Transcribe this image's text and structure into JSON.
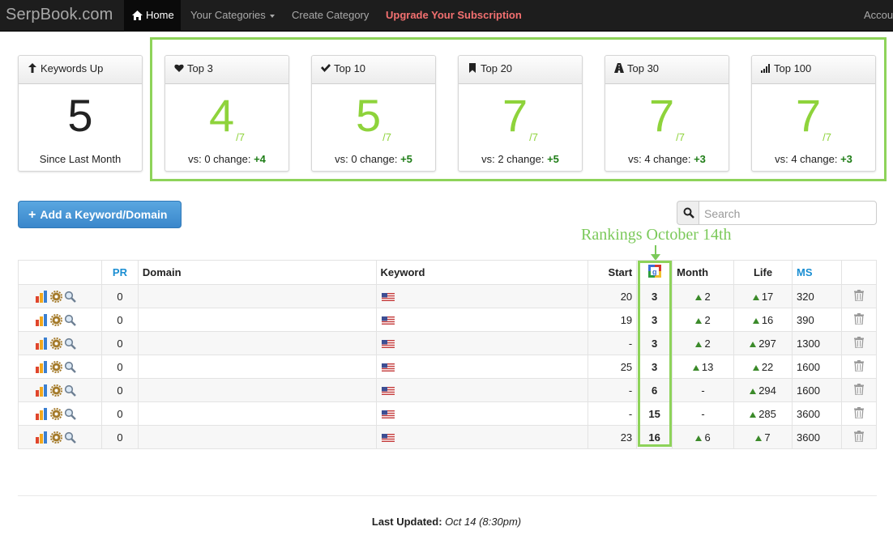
{
  "nav": {
    "brand": "SerpBook.com",
    "home": "Home",
    "categories": "Your Categories",
    "create": "Create Category",
    "upgrade": "Upgrade Your Subscription",
    "account": "Accou"
  },
  "cards": [
    {
      "title": "Keywords Up",
      "icon": "arrow-up-icon",
      "value": "5",
      "denom": "",
      "foot": "Since Last Month",
      "delta": ""
    },
    {
      "title": "Top 3",
      "icon": "heart-icon",
      "value": "4",
      "denom": "/7",
      "foot": "vs: 0 change:",
      "delta": "+4"
    },
    {
      "title": "Top 10",
      "icon": "check-icon",
      "value": "5",
      "denom": "/7",
      "foot": "vs: 0 change:",
      "delta": "+5"
    },
    {
      "title": "Top 20",
      "icon": "bookmark-icon",
      "value": "7",
      "denom": "/7",
      "foot": "vs: 2 change:",
      "delta": "+5"
    },
    {
      "title": "Top 30",
      "icon": "road-icon",
      "value": "7",
      "denom": "/7",
      "foot": "vs: 4 change:",
      "delta": "+3"
    },
    {
      "title": "Top 100",
      "icon": "signal-icon",
      "value": "7",
      "denom": "/7",
      "foot": "vs: 4 change:",
      "delta": "+3"
    }
  ],
  "add_button": "Add a Keyword/Domain",
  "search": {
    "placeholder": "Search"
  },
  "annotation": "Rankings October 14th",
  "table": {
    "headers": {
      "pr": "PR",
      "domain": "Domain",
      "keyword": "Keyword",
      "start": "Start",
      "month": "Month",
      "life": "Life",
      "ms": "MS"
    },
    "rows": [
      {
        "pr": "0",
        "start": "20",
        "rank": "3",
        "month": "2",
        "month_up": true,
        "life": "17",
        "ms": "320"
      },
      {
        "pr": "0",
        "start": "19",
        "rank": "3",
        "month": "2",
        "month_up": true,
        "life": "16",
        "ms": "390"
      },
      {
        "pr": "0",
        "start": "-",
        "rank": "3",
        "month": "2",
        "month_up": true,
        "life": "297",
        "ms": "1300"
      },
      {
        "pr": "0",
        "start": "25",
        "rank": "3",
        "month": "13",
        "month_up": true,
        "life": "22",
        "ms": "1600"
      },
      {
        "pr": "0",
        "start": "-",
        "rank": "6",
        "month": "-",
        "month_up": false,
        "life": "294",
        "ms": "1600"
      },
      {
        "pr": "0",
        "start": "-",
        "rank": "15",
        "month": "-",
        "month_up": false,
        "life": "285",
        "ms": "3600"
      },
      {
        "pr": "0",
        "start": "23",
        "rank": "16",
        "month": "6",
        "month_up": true,
        "life": "7",
        "ms": "3600"
      }
    ]
  },
  "footer": {
    "label": "Last Updated:",
    "value": "Oct 14 (8:30pm)"
  },
  "colors": {
    "accent_green": "#8ed33b",
    "delta_green": "#1e7d16",
    "link_blue": "#1a8ed2",
    "button_blue": "#3a87cb"
  }
}
